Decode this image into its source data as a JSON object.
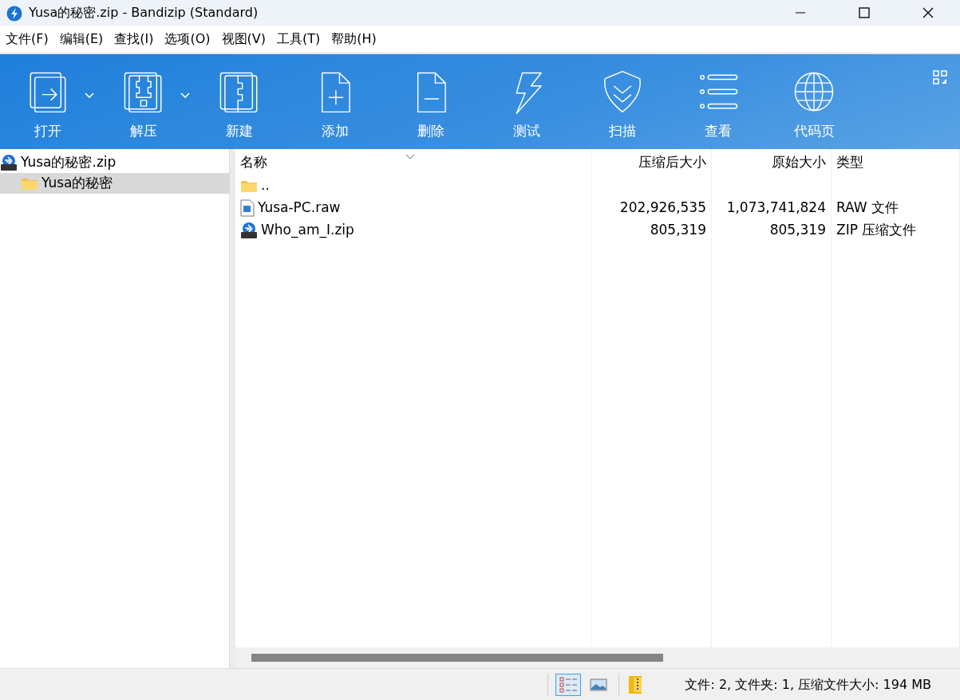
{
  "window": {
    "title": "Yusa的秘密.zip - Bandizip (Standard)"
  },
  "menu": [
    "文件(F)",
    "编辑(E)",
    "查找(I)",
    "选项(O)",
    "视图(V)",
    "工具(T)",
    "帮助(H)"
  ],
  "toolbar": [
    {
      "kind": "open",
      "label": "打开",
      "dropdown": true
    },
    {
      "kind": "extract",
      "label": "解压",
      "dropdown": true
    },
    {
      "kind": "new",
      "label": "新建",
      "dropdown": false
    },
    {
      "kind": "add",
      "label": "添加",
      "dropdown": false
    },
    {
      "kind": "delete",
      "label": "删除",
      "dropdown": false
    },
    {
      "kind": "test",
      "label": "测试",
      "dropdown": false
    },
    {
      "kind": "scan",
      "label": "扫描",
      "dropdown": false
    },
    {
      "kind": "view",
      "label": "查看",
      "dropdown": false
    },
    {
      "kind": "codepage",
      "label": "代码页",
      "dropdown": false
    }
  ],
  "tree": [
    {
      "kind": "zip",
      "label": "Yusa的秘密.zip",
      "selected": false,
      "children": [
        {
          "kind": "folder",
          "label": "Yusa的秘密",
          "selected": true
        }
      ]
    }
  ],
  "table": {
    "columns": [
      "名称",
      "压缩后大小",
      "原始大小",
      "类型"
    ],
    "rows": [
      {
        "kind": "folder",
        "cells": [
          "..",
          "",
          "",
          ""
        ]
      },
      {
        "kind": "image",
        "cells": [
          "Yusa-PC.raw",
          "202,926,535",
          "1,073,741,824",
          "RAW 文件"
        ]
      },
      {
        "kind": "zip",
        "cells": [
          "Who_am_I.zip",
          "805,319",
          "805,319",
          "ZIP 压缩文件"
        ]
      }
    ]
  },
  "status_bar": {
    "views": [
      {
        "kind": "details",
        "selected": true
      },
      {
        "kind": "thumbnail",
        "selected": false
      }
    ],
    "text": "文件: 2, 文件夹: 1, 压缩文件大小: 194 MB"
  }
}
